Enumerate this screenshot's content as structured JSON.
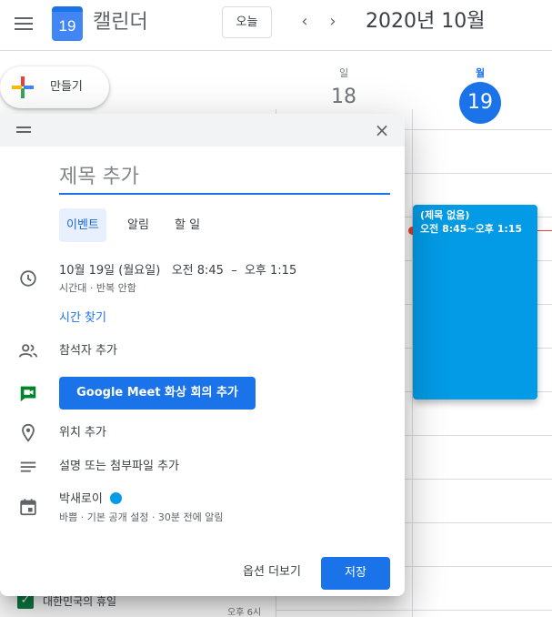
{
  "header": {
    "logo_day": "19",
    "app_title": "캘린더",
    "today_label": "오늘",
    "prev_icon": "‹",
    "next_icon": "›",
    "month_title": "2020년 10월"
  },
  "sidebar": {
    "create_label": "만들기",
    "calendar_item": "대한민국의 휴일",
    "time_label": "오후 6시",
    "calendar_color": "#0b8043"
  },
  "grid": {
    "days": [
      {
        "dow": "일",
        "num": "18"
      },
      {
        "dow": "월",
        "num": "19"
      }
    ],
    "event": {
      "title": "(제목 없음)",
      "time": "오전 8:45~오후 1:15",
      "color": "#039be5"
    }
  },
  "dialog": {
    "title_placeholder": "제목 추가",
    "tabs": [
      "이벤트",
      "알림",
      "할 일"
    ],
    "datetime": "10월 19일 (월요일)   오전 8:45  –  오후 1:15",
    "datetime_sub": "시간대 · 반복 안함",
    "find_time": "시간 찾기",
    "guests": "참석자 추가",
    "meet_button": "Google Meet 화상 회의 추가",
    "location": "위치 추가",
    "description": "설명 또는 첨부파일 추가",
    "calendar_owner": "박새로이",
    "calendar_sub": "바쁨 · 기본 공개 설정 · 30분 전에 알림",
    "more_options": "옵션 더보기",
    "save": "저장",
    "close_icon": "×"
  },
  "colors": {
    "accent": "#1a73e8",
    "event": "#039be5",
    "now_line": "#ea4335"
  }
}
